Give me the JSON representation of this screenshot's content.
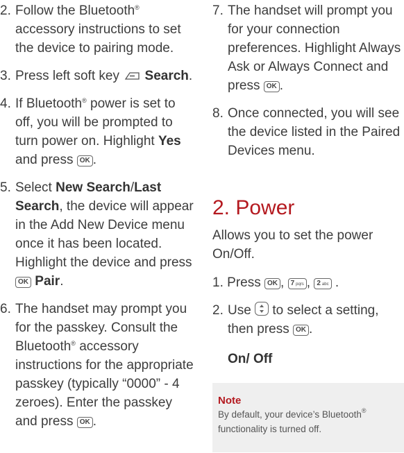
{
  "left": {
    "s2": {
      "num": "2.",
      "a": "Follow the Bluetooth",
      "reg": "®",
      "b": "accessory instructions to set the device to pairing mode."
    },
    "s3": {
      "num": "3.",
      "a": "Press left soft key",
      "b": "Search",
      "c": "."
    },
    "s4": {
      "num": "4.",
      "a": "If Bluetooth",
      "reg": "®",
      "b": "power is set to off, you will be prompted to turn power on. Highlight",
      "yes": "Yes",
      "c": "and press",
      "d": "."
    },
    "s5": {
      "num": "5.",
      "a": "Select",
      "b": "New Search",
      "slash": "/",
      "c": "Last Search",
      "d": ", the device will appear in the Add New Device menu once it has been located. Highlight the device and press",
      "pair": "Pair",
      "e": "."
    },
    "s6": {
      "num": "6.",
      "a": "The handset may prompt you for the passkey. Consult the Bluetooth",
      "reg": "®",
      "b": "accessory instructions for the appropriate passkey (typically “0000” - 4 zeroes). Enter the passkey and press",
      "c": "."
    }
  },
  "right": {
    "s7": {
      "num": "7.",
      "a": "The handset will prompt you for your connection preferences. Highlight Always Ask or Always Connect and press",
      "b": "."
    },
    "s8": {
      "num": "8.",
      "a": "Once connected, you will see the device listed in the Paired Devices menu."
    },
    "heading": "2. Power",
    "intro": "Allows you to set the power On/Off.",
    "p1": {
      "num": "1.",
      "a": "Press",
      "sep1": ",",
      "sep2": ",",
      "end": "."
    },
    "p2": {
      "num": "2.",
      "a": "Use",
      "b": "to select a setting, then press",
      "c": "."
    },
    "options": "On/ Off",
    "note": {
      "title": "Note",
      "a": "By default, your device’s Bluetooth",
      "reg": "®",
      "b": "functionality is turned off."
    }
  },
  "keys": {
    "ok": "OK",
    "seven": "7",
    "seven_sub": "pqrs",
    "two": "2",
    "two_sub": "abc"
  },
  "icons": {
    "softkey": "left-soft-key-icon",
    "nav": "navigation-key-icon"
  },
  "colors": {
    "heading": "#b4191f",
    "note_bg": "#efefef",
    "text": "#3d3d3d"
  }
}
